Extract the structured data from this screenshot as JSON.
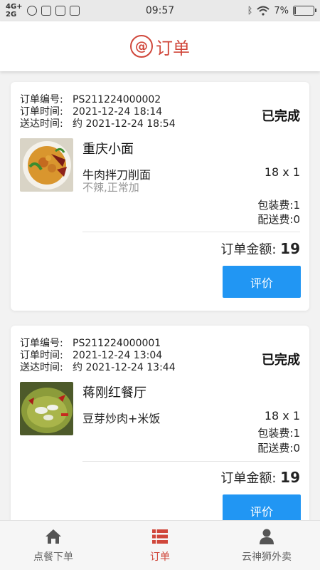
{
  "status_bar": {
    "network_top": "4G+",
    "network_bottom": "2G",
    "time": "09:57",
    "battery": "7%",
    "battery_level": 0.07
  },
  "header": {
    "title": "订单",
    "accent_color": "#d0473b"
  },
  "labels": {
    "order_no": "订单编号:",
    "order_time": "订单时间:",
    "delivery_time": "送达时间:",
    "packing_fee": "包装费:",
    "delivery_fee": "配送费:",
    "total": "订单金额:",
    "review_button": "评价"
  },
  "orders": [
    {
      "order_no": "PS211224000002",
      "order_time": "2021-12-24 18:14",
      "delivery_time": "约 2021-12-24 18:54",
      "status": "已完成",
      "shop": "重庆小面",
      "dish": "牛肉拌刀削面",
      "note": "不辣,正常加",
      "qty": "18 x 1",
      "packing_fee": "1",
      "delivery_fee": "0",
      "total": "19",
      "image": "noodles-photo"
    },
    {
      "order_no": "PS211224000001",
      "order_time": "2021-12-24 13:04",
      "delivery_time": "约 2021-12-24 13:44",
      "status": "已完成",
      "shop": "蒋刚红餐厅",
      "dish": "豆芽炒肉+米饭",
      "note": "",
      "qty": "18 x 1",
      "packing_fee": "1",
      "delivery_fee": "0",
      "total": "19",
      "image": "fish-dish-photo"
    }
  ],
  "nav": {
    "items": [
      {
        "label": "点餐下单",
        "icon": "home-icon"
      },
      {
        "label": "订单",
        "icon": "list-icon",
        "active": true
      },
      {
        "label": "云神狮外卖",
        "icon": "user-icon"
      }
    ]
  },
  "colors": {
    "button": "#2196f3"
  }
}
